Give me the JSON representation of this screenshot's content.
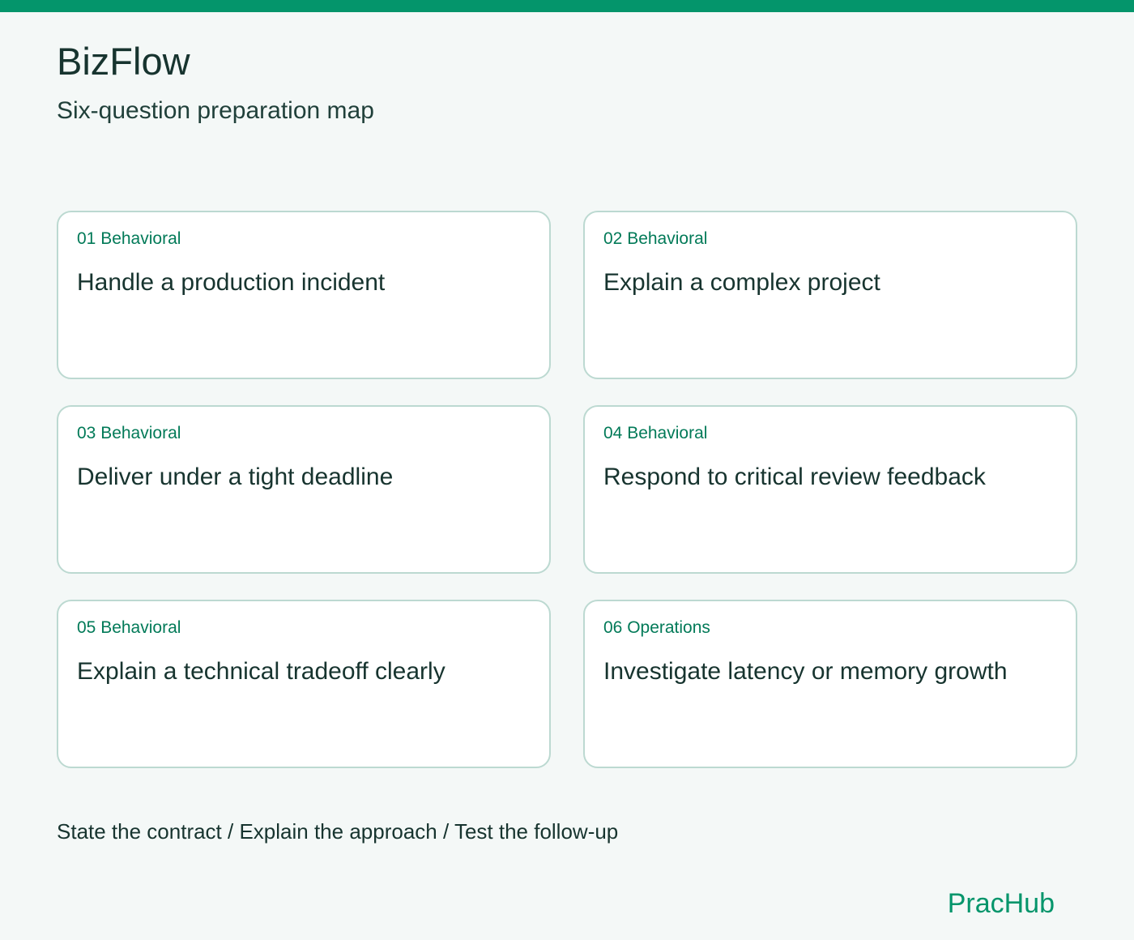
{
  "app": {
    "title": "BizFlow",
    "subtitle": "Six-question preparation map",
    "accent_color": "#04956b"
  },
  "cards": [
    {
      "tag": "01 Behavioral",
      "title": "Handle a production incident"
    },
    {
      "tag": "02 Behavioral",
      "title": "Explain a complex project"
    },
    {
      "tag": "03 Behavioral",
      "title": "Deliver under a tight deadline"
    },
    {
      "tag": "04 Behavioral",
      "title": "Respond to critical review feedback"
    },
    {
      "tag": "05 Behavioral",
      "title": "Explain a technical tradeoff clearly"
    },
    {
      "tag": "06 Operations",
      "title": "Investigate latency or memory growth"
    }
  ],
  "footer": {
    "steps": "State the contract / Explain the approach / Test the follow-up",
    "brand": "PracHub"
  }
}
